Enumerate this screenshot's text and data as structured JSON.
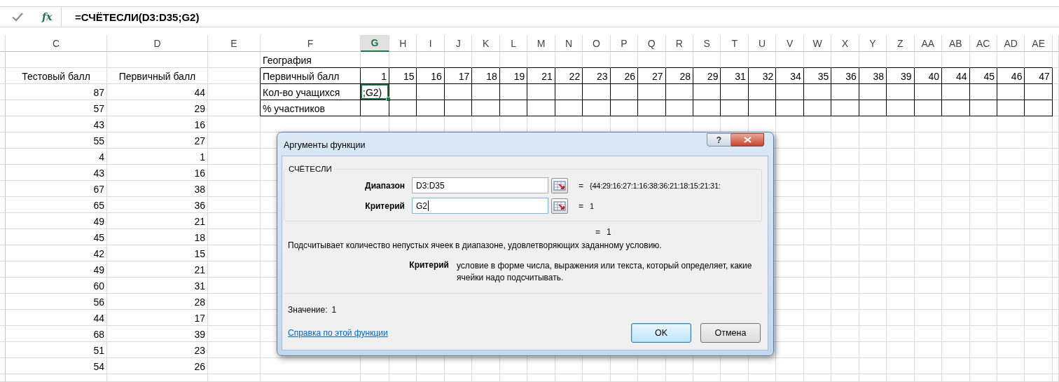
{
  "formula_bar": {
    "function_label": "fx",
    "formula": "=СЧЁТЕСЛИ(D3:D35;G2)"
  },
  "columns": [
    {
      "label": "C",
      "selected": false
    },
    {
      "label": "D",
      "selected": false
    },
    {
      "label": "E",
      "selected": false
    },
    {
      "label": "F",
      "selected": false
    },
    {
      "label": "G",
      "selected": true
    },
    {
      "label": "H",
      "selected": false
    },
    {
      "label": "I",
      "selected": false
    },
    {
      "label": "J",
      "selected": false
    },
    {
      "label": "K",
      "selected": false
    },
    {
      "label": "L",
      "selected": false
    },
    {
      "label": "M",
      "selected": false
    },
    {
      "label": "N",
      "selected": false
    },
    {
      "label": "O",
      "selected": false
    },
    {
      "label": "P",
      "selected": false
    },
    {
      "label": "Q",
      "selected": false
    },
    {
      "label": "R",
      "selected": false
    },
    {
      "label": "S",
      "selected": false
    },
    {
      "label": "T",
      "selected": false
    },
    {
      "label": "U",
      "selected": false
    },
    {
      "label": "V",
      "selected": false
    },
    {
      "label": "W",
      "selected": false
    },
    {
      "label": "X",
      "selected": false
    },
    {
      "label": "Y",
      "selected": false
    },
    {
      "label": "Z",
      "selected": false
    },
    {
      "label": "AA",
      "selected": false
    },
    {
      "label": "AB",
      "selected": false
    },
    {
      "label": "AC",
      "selected": false
    },
    {
      "label": "AD",
      "selected": false
    },
    {
      "label": "AE",
      "selected": false
    }
  ],
  "score_table": {
    "headers": [
      "Тестовый балл",
      "Первичный балл"
    ],
    "rows": [
      [
        "87",
        "44"
      ],
      [
        "57",
        "29"
      ],
      [
        "43",
        "16"
      ],
      [
        "55",
        "27"
      ],
      [
        "4",
        "1"
      ],
      [
        "43",
        "16"
      ],
      [
        "67",
        "38"
      ],
      [
        "65",
        "36"
      ],
      [
        "49",
        "21"
      ],
      [
        "45",
        "18"
      ],
      [
        "42",
        "15"
      ],
      [
        "49",
        "21"
      ],
      [
        "60",
        "31"
      ],
      [
        "56",
        "28"
      ],
      [
        "44",
        "17"
      ],
      [
        "68",
        "39"
      ],
      [
        "51",
        "23"
      ],
      [
        "54",
        "26"
      ]
    ]
  },
  "summary_table": {
    "title": "География",
    "rows": [
      {
        "label": "Первичный балл",
        "active": false,
        "values": [
          "1",
          "15",
          "16",
          "17",
          "18",
          "19",
          "21",
          "22",
          "23",
          "26",
          "27",
          "28",
          "29",
          "31",
          "32",
          "34",
          "35",
          "36",
          "38",
          "39",
          "40",
          "44",
          "45",
          "46",
          "47"
        ]
      },
      {
        "label": "Кол-во учащихся",
        "active": true,
        "values": [
          ";G2)"
        ]
      },
      {
        "label": "% участников",
        "active": false
      }
    ]
  },
  "dialog": {
    "title": "Аргументы функции",
    "help_button": "?",
    "function_name": "СЧЁТЕСЛИ",
    "arguments": [
      {
        "label": "Диапазон",
        "value": "D3:D35",
        "focused": false,
        "sign": "=",
        "result": "{44:29:16:27:1:16:38:36:21:18:15:21:31:"
      },
      {
        "label": "Критерий",
        "value": "G2",
        "focused": true,
        "sign": "=",
        "result": "1"
      }
    ],
    "formula_result": {
      "sign": "=",
      "value": "1"
    },
    "description": "Подсчитывает количество непустых ячеек в диапазоне, удовлетворяющих заданному условию.",
    "argument_help": {
      "label": "Критерий",
      "text": "условие в форме числа, выражения или текста, который определяет, какие ячейки надо подсчитывать."
    },
    "value_label": "Значение:",
    "value": "1",
    "help_link": "Справка по этой функции",
    "buttons": [
      {
        "label": "OK",
        "default": true
      },
      {
        "label": "Отмена",
        "default": false
      }
    ]
  }
}
